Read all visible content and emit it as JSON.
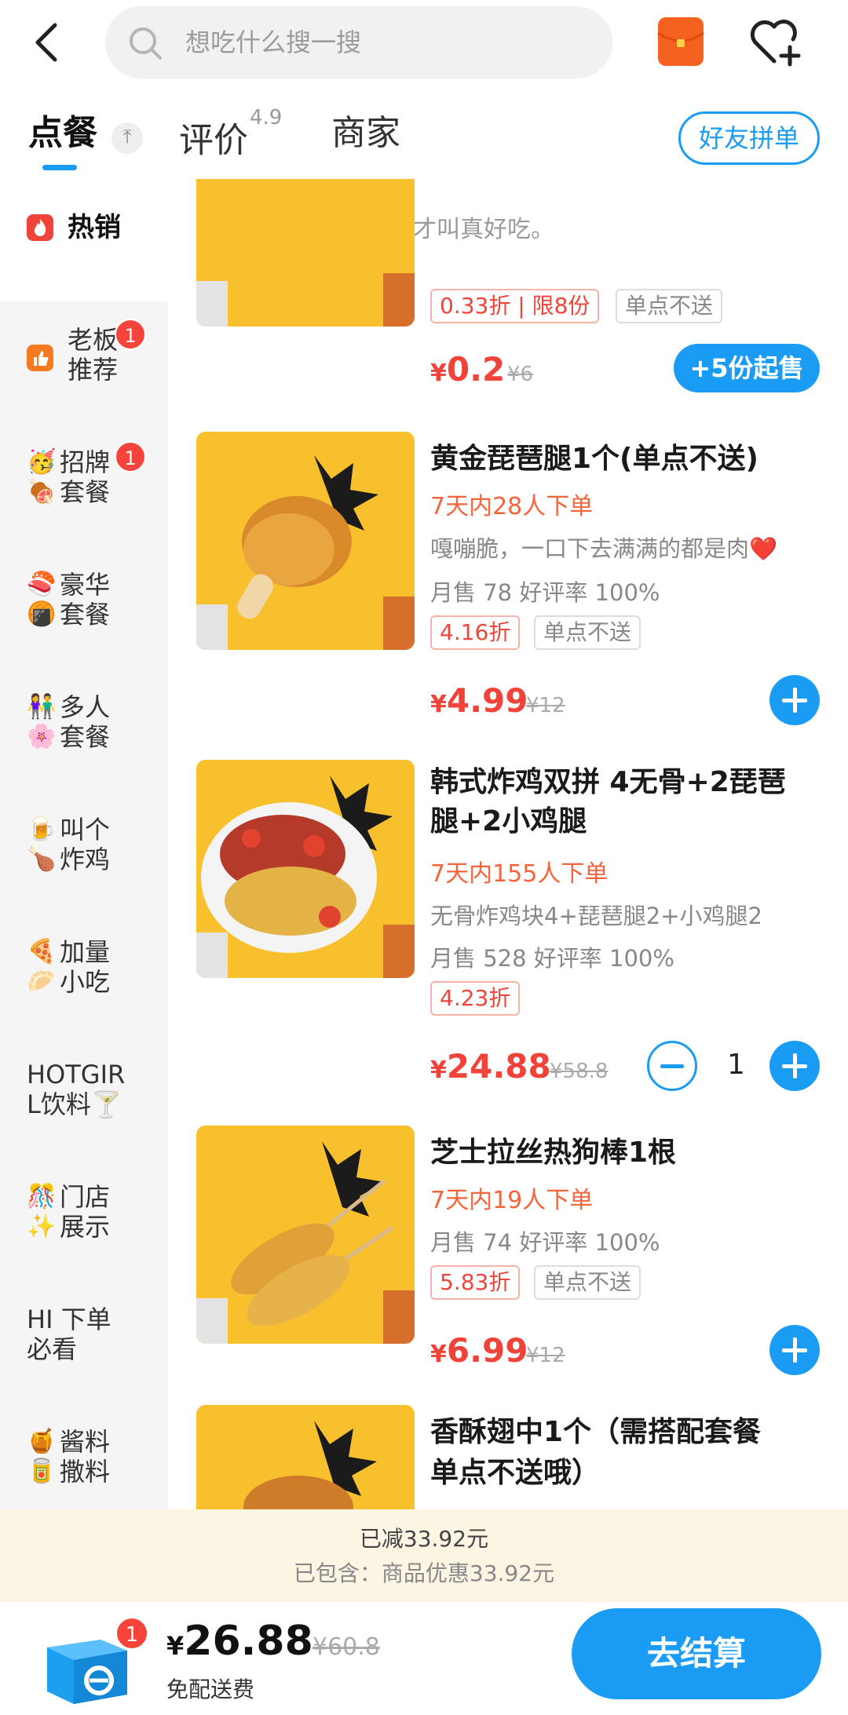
{
  "search": {
    "placeholder": "想吃什么搜一搜"
  },
  "tabs": [
    {
      "label": "点餐"
    },
    {
      "label": "评价",
      "rating": "4.9"
    },
    {
      "label": "商家"
    }
  ],
  "group_button": "好友拼单",
  "sidebar": {
    "items": [
      {
        "label": "热销",
        "icon": "fire-icon"
      },
      {
        "label": "老板推荐",
        "line1": "老板",
        "line2": "推荐",
        "icon": "thumbs-up-icon",
        "badge": "1"
      },
      {
        "label": "招牌套餐",
        "line1": "招牌",
        "line2": "套餐",
        "emoji1": "🥳",
        "emoji2": "🍖",
        "badge": "1"
      },
      {
        "label": "豪华套餐",
        "line1": "豪华",
        "line2": "套餐",
        "emoji1": "🍣",
        "emoji2": "🍘"
      },
      {
        "label": "多人套餐",
        "line1": "多人",
        "line2": "套餐",
        "emoji1": "👫",
        "emoji2": "🌸"
      },
      {
        "label": "叫个炸鸡",
        "line1": "叫个",
        "line2": "炸鸡",
        "emoji1": "🍺",
        "emoji2": "🍗"
      },
      {
        "label": "加量小吃",
        "line1": "加量",
        "line2": "小吃",
        "emoji1": "🍕",
        "emoji2": "🥟"
      },
      {
        "label": "HOTGIRL饮料",
        "line1": "HOTGIR",
        "line2": "L饮料🍸"
      },
      {
        "label": "门店展示",
        "line1": "门店",
        "line2": "展示",
        "emoji1": "🎊",
        "emoji2": "✨"
      },
      {
        "label": "HI 下单必看",
        "line1": "HI 下单",
        "line2": "必看"
      },
      {
        "label": "酱料撒料",
        "line1": "酱料",
        "line2": "撒料",
        "emoji1": "🍯",
        "emoji2": "🥫"
      }
    ]
  },
  "section": {
    "title": "热销",
    "desc": "大家喜欢吃，才叫真好吃。"
  },
  "products": [
    {
      "tags": [
        "0.33折 | 限8份",
        "单点不送"
      ],
      "price": "0.2",
      "orig_price": "¥6",
      "min_buy": "+5份起售"
    },
    {
      "name": "黄金琵琶腿1个(单点不送)",
      "orders": "7天内28人下单",
      "desc": "嘎嘣脆，一口下去满满的都是肉❤️",
      "sales": "月售 78 好评率 100%",
      "tags": [
        "4.16折",
        "单点不送"
      ],
      "price": "4.99",
      "orig_price": "¥12"
    },
    {
      "name_line1": "韩式炸鸡双拼 4无骨+2琵琶",
      "name_line2": "腿+2小鸡腿",
      "orders": "7天内155人下单",
      "desc": "无骨炸鸡块4+琵琶腿2+小鸡腿2",
      "sales": "月售 528 好评率 100%",
      "tags": [
        "4.23折"
      ],
      "price": "24.88",
      "orig_price": "¥58.8",
      "quantity": "1"
    },
    {
      "name": "芝士拉丝热狗棒1根",
      "orders": "7天内19人下单",
      "sales": "月售 74 好评率 100%",
      "tags": [
        "5.83折",
        "单点不送"
      ],
      "price": "6.99",
      "orig_price": "¥12"
    },
    {
      "name_line1": "香酥翅中1个（需搭配套餐",
      "name_line2": "单点不送哦）"
    }
  ],
  "discount": {
    "line1": "已减33.92元",
    "line2": "已包含：商品优惠33.92元"
  },
  "bottom": {
    "cart_count": "1",
    "currency": "¥",
    "total": "26.88",
    "orig_total": "¥60.8",
    "delivery": "免配送费",
    "checkout": "去结算"
  },
  "colors": {
    "accent": "#1a9cf5",
    "price": "#f0443a",
    "badge": "#f5443b",
    "discount_bg": "#fcf5e4"
  }
}
